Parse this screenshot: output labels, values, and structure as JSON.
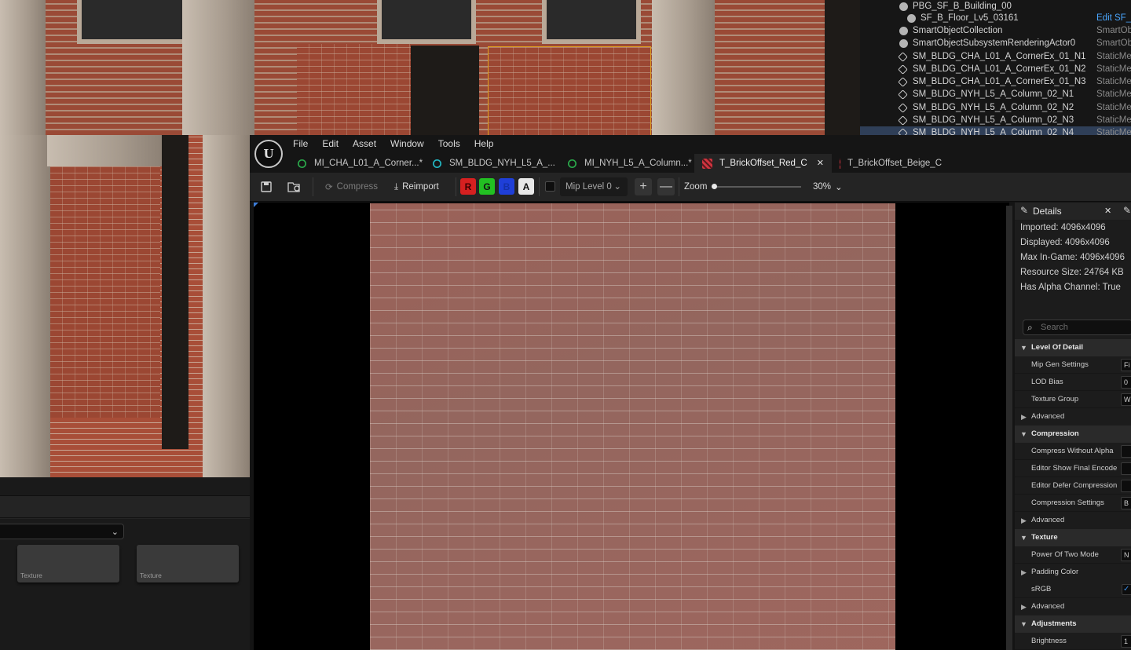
{
  "outliner": {
    "rows": [
      {
        "name": "PBG_SF_B_Building_00",
        "type": "",
        "icon": "actor-icon"
      },
      {
        "name": "SF_B_Floor_Lv5_03161",
        "type": "Edit SF_B",
        "icon": "actor-icon"
      },
      {
        "name": "SmartObjectCollection",
        "type": "SmartObj",
        "icon": "actor-icon"
      },
      {
        "name": "SmartObjectSubsystemRenderingActor0",
        "type": "SmartObj",
        "icon": "actor-icon"
      },
      {
        "name": "SM_BLDG_CHA_L01_A_CornerEx_01_N1",
        "type": "StaticMes",
        "icon": "static-mesh-icon"
      },
      {
        "name": "SM_BLDG_CHA_L01_A_CornerEx_01_N2",
        "type": "StaticMes",
        "icon": "static-mesh-icon"
      },
      {
        "name": "SM_BLDG_CHA_L01_A_CornerEx_01_N3",
        "type": "StaticMes",
        "icon": "static-mesh-icon"
      },
      {
        "name": "SM_BLDG_NYH_L5_A_Column_02_N1",
        "type": "StaticMes",
        "icon": "static-mesh-icon"
      },
      {
        "name": "SM_BLDG_NYH_L5_A_Column_02_N2",
        "type": "StaticMes",
        "icon": "static-mesh-icon"
      },
      {
        "name": "SM_BLDG_NYH_L5_A_Column_02_N3",
        "type": "StaticMes",
        "icon": "static-mesh-icon"
      },
      {
        "name": "SM_BLDG_NYH_L5_A_Column_02_N4",
        "type": "StaticMes",
        "icon": "static-mesh-icon"
      }
    ]
  },
  "content_browser": {
    "tiles": [
      {
        "label": "Texture"
      },
      {
        "label": "Texture"
      }
    ]
  },
  "editor": {
    "logo": "U",
    "menu": [
      "File",
      "Edit",
      "Asset",
      "Window",
      "Tools",
      "Help"
    ],
    "tabs": [
      {
        "label": "MI_CHA_L01_A_Corner...*",
        "icon": "material-instance-icon",
        "active": false
      },
      {
        "label": "SM_BLDG_NYH_L5_A_...",
        "icon": "static-mesh-icon",
        "active": false
      },
      {
        "label": "MI_NYH_L5_A_Column...*",
        "icon": "material-instance-icon",
        "active": false
      },
      {
        "label": "T_BrickOffset_Red_C",
        "icon": "texture-icon",
        "active": true
      },
      {
        "label": "T_BrickOffset_Beige_C",
        "icon": "texture-icon",
        "active": false
      }
    ],
    "toolbar": {
      "compress_label": "Compress",
      "reimport_label": "Reimport",
      "channels": [
        {
          "label": "R",
          "color": "#d62020"
        },
        {
          "label": "G",
          "color": "#22c022"
        },
        {
          "label": "B",
          "color": "#1f3fd8"
        },
        {
          "label": "A",
          "color": "#e8e8e8"
        }
      ],
      "mip_level": "Mip Level 0",
      "plus": "+",
      "minus": "—",
      "zoom_label": "Zoom",
      "zoom_value": "30%",
      "zoom_slider_fraction": 0.0
    }
  },
  "details": {
    "title": "Details",
    "info": [
      "Imported: 4096x4096",
      "Displayed: 4096x4096",
      "Max In-Game: 4096x4096",
      "Resource Size: 24764 KB",
      "Has Alpha Channel: True"
    ],
    "search_placeholder": "Search",
    "rows": [
      {
        "kind": "cat",
        "label": "Level Of Detail"
      },
      {
        "kind": "prop",
        "label": "Mip Gen Settings",
        "value": "Fi"
      },
      {
        "kind": "prop",
        "label": "LOD Bias",
        "value": "0"
      },
      {
        "kind": "prop",
        "label": "Texture Group",
        "value": "W"
      },
      {
        "kind": "sub",
        "label": "Advanced"
      },
      {
        "kind": "cat",
        "label": "Compression"
      },
      {
        "kind": "prop",
        "label": "Compress Without Alpha",
        "value": ""
      },
      {
        "kind": "prop",
        "label": "Editor Show Final Encode",
        "value": ""
      },
      {
        "kind": "prop",
        "label": "Editor Defer Compression",
        "value": ""
      },
      {
        "kind": "prop",
        "label": "Compression Settings",
        "value": "B"
      },
      {
        "kind": "sub",
        "label": "Advanced"
      },
      {
        "kind": "cat",
        "label": "Texture"
      },
      {
        "kind": "prop",
        "label": "Power Of Two Mode",
        "value": "N"
      },
      {
        "kind": "sub",
        "label": "Padding Color"
      },
      {
        "kind": "check",
        "label": "sRGB",
        "value": "✓"
      },
      {
        "kind": "sub",
        "label": "Advanced"
      },
      {
        "kind": "cat",
        "label": "Adjustments"
      },
      {
        "kind": "prop",
        "label": "Brightness",
        "value": "1"
      }
    ]
  }
}
